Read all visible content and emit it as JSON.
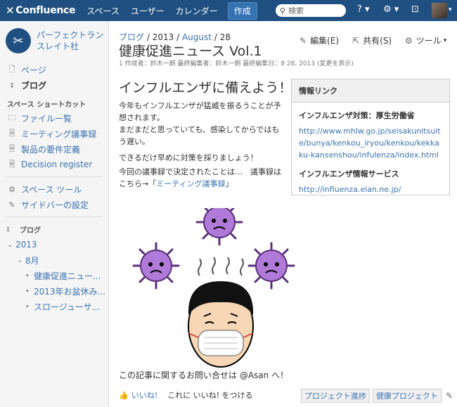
{
  "topnav": {
    "logo": "Confluence",
    "items": [
      "スペース",
      "ユーザー",
      "カレンダー"
    ],
    "create": "作成",
    "search_placeholder": "検索"
  },
  "sidebar": {
    "space_name": "パーフェクトランスレイト社",
    "items": [
      {
        "label": "ページ",
        "icon": "page-icon"
      },
      {
        "label": "ブログ",
        "icon": "blog-icon"
      }
    ],
    "shortcuts_title": "スペース ショートカット",
    "shortcuts": [
      {
        "label": "ファイル一覧",
        "icon": "folder-icon"
      },
      {
        "label": "ミーティング議事録",
        "icon": "document-icon"
      },
      {
        "label": "製品の要件定義",
        "icon": "document-icon"
      },
      {
        "label": "Decision register",
        "icon": "document-icon"
      }
    ],
    "tools": [
      {
        "label": "スペース ツール",
        "icon": "gear-icon"
      },
      {
        "label": "サイドバーの設定",
        "icon": "pencil-icon"
      }
    ],
    "blog_title": "ブログ",
    "tree": {
      "year": "2013",
      "month": "8月",
      "posts": [
        "健康促進ニュー...",
        "2013年お盆休み...",
        "スロージューサ..."
      ]
    }
  },
  "breadcrumb": {
    "blog": "ブログ",
    "sep": "/",
    "year": "2013",
    "month": "August",
    "day": "28"
  },
  "actions": {
    "edit": "編集(E)",
    "share": "共有(S)",
    "tools": "ツール"
  },
  "page": {
    "title": "健康促進ニュース Vol.1",
    "meta": "1 作成者：鈴木一朗 最終編集者：鈴木一朗 最終編集日：8 28, 2013 (変更を表示)",
    "heading": "インフルエンザに備えよう！",
    "p1": "今年もインフルエンザが猛威を振るうことが予想されます。",
    "p2": "まだまだと思っていても、感染してからではもう遅い。",
    "p3": "できるだけ早めに対策を採りましょう！",
    "p4a": "今回の議事録で決定されたことは…　議事録はこちら→「",
    "p4link": "ミーティング議事録",
    "p4b": "」",
    "footer_q": "この記事に関するお問い合せは @Asan へ！"
  },
  "info": {
    "title": "情報リンク",
    "sub1": "インフルエンザ対策：厚生労働省",
    "url1": "http://www.mhlw.go.jp/seisakunitsuite/bunya/kenkou_iryou/kenkou/kekkaku-kansenshou/infulenza/index.html",
    "sub2": "インフルエンザ情報サービス",
    "url2": "http://influenza.elan.ne.jp/"
  },
  "like": {
    "like": "いいね!",
    "prompt": "これに いいね! をつける"
  },
  "labels": [
    "プロジェクト進捗",
    "健康プロジェクト"
  ]
}
